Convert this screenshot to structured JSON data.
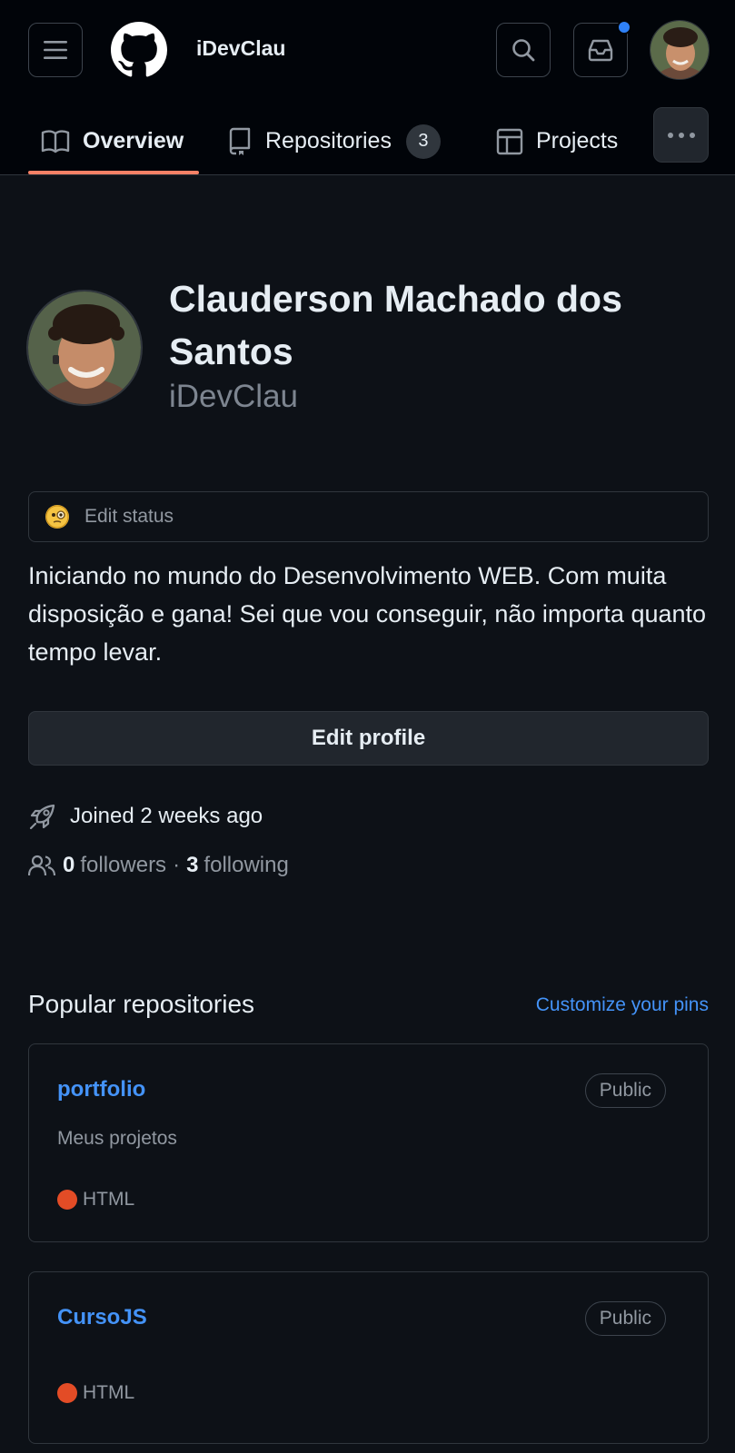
{
  "header": {
    "username": "iDevClau",
    "notification_dot_color": "#2f81f7"
  },
  "tabs": [
    {
      "label": "Overview",
      "icon": "book-icon",
      "selected": true
    },
    {
      "label": "Repositories",
      "icon": "repo-icon",
      "count": "3"
    },
    {
      "label": "Projects",
      "icon": "table-icon"
    }
  ],
  "profile": {
    "full_name": "Clauderson Machado dos Santos",
    "login": "iDevClau",
    "status_label": "Edit status",
    "bio": "Iniciando no mundo do Desenvolvimento WEB. Com muita disposição e gana! Sei que vou conseguir, não importa quanto tempo levar.",
    "edit_profile_label": "Edit profile",
    "joined": "Joined 2 weeks ago",
    "followers_count": "0",
    "followers_label": "followers",
    "separator": "·",
    "following_count": "3",
    "following_label": "following"
  },
  "popular": {
    "title": "Popular repositories",
    "customize_label": "Customize your pins",
    "repos": [
      {
        "name": "portfolio",
        "visibility": "Public",
        "description": "Meus projetos",
        "language": "HTML",
        "language_color": "#e34c26"
      },
      {
        "name": "CursoJS",
        "visibility": "Public",
        "description": "",
        "language": "HTML",
        "language_color": "#e34c26"
      }
    ]
  },
  "colors": {
    "background": "#0d1117",
    "header_background": "#010409",
    "accent_underline": "#f78166",
    "link": "#4493f8"
  }
}
